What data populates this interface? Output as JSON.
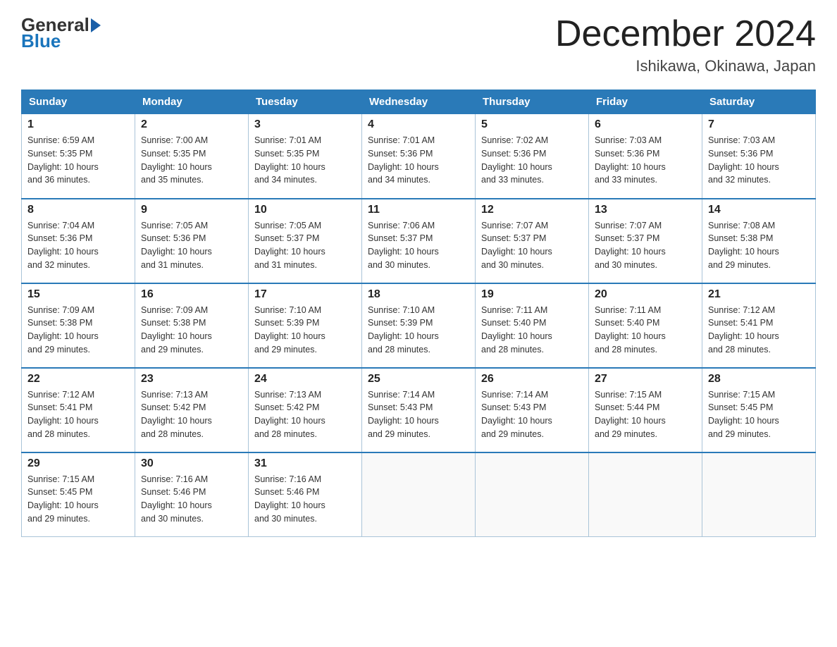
{
  "logo": {
    "general": "General",
    "blue": "Blue"
  },
  "title": "December 2024",
  "location": "Ishikawa, Okinawa, Japan",
  "headers": [
    "Sunday",
    "Monday",
    "Tuesday",
    "Wednesday",
    "Thursday",
    "Friday",
    "Saturday"
  ],
  "weeks": [
    [
      {
        "day": "1",
        "sunrise": "6:59 AM",
        "sunset": "5:35 PM",
        "daylight": "10 hours and 36 minutes."
      },
      {
        "day": "2",
        "sunrise": "7:00 AM",
        "sunset": "5:35 PM",
        "daylight": "10 hours and 35 minutes."
      },
      {
        "day": "3",
        "sunrise": "7:01 AM",
        "sunset": "5:35 PM",
        "daylight": "10 hours and 34 minutes."
      },
      {
        "day": "4",
        "sunrise": "7:01 AM",
        "sunset": "5:36 PM",
        "daylight": "10 hours and 34 minutes."
      },
      {
        "day": "5",
        "sunrise": "7:02 AM",
        "sunset": "5:36 PM",
        "daylight": "10 hours and 33 minutes."
      },
      {
        "day": "6",
        "sunrise": "7:03 AM",
        "sunset": "5:36 PM",
        "daylight": "10 hours and 33 minutes."
      },
      {
        "day": "7",
        "sunrise": "7:03 AM",
        "sunset": "5:36 PM",
        "daylight": "10 hours and 32 minutes."
      }
    ],
    [
      {
        "day": "8",
        "sunrise": "7:04 AM",
        "sunset": "5:36 PM",
        "daylight": "10 hours and 32 minutes."
      },
      {
        "day": "9",
        "sunrise": "7:05 AM",
        "sunset": "5:36 PM",
        "daylight": "10 hours and 31 minutes."
      },
      {
        "day": "10",
        "sunrise": "7:05 AM",
        "sunset": "5:37 PM",
        "daylight": "10 hours and 31 minutes."
      },
      {
        "day": "11",
        "sunrise": "7:06 AM",
        "sunset": "5:37 PM",
        "daylight": "10 hours and 30 minutes."
      },
      {
        "day": "12",
        "sunrise": "7:07 AM",
        "sunset": "5:37 PM",
        "daylight": "10 hours and 30 minutes."
      },
      {
        "day": "13",
        "sunrise": "7:07 AM",
        "sunset": "5:37 PM",
        "daylight": "10 hours and 30 minutes."
      },
      {
        "day": "14",
        "sunrise": "7:08 AM",
        "sunset": "5:38 PM",
        "daylight": "10 hours and 29 minutes."
      }
    ],
    [
      {
        "day": "15",
        "sunrise": "7:09 AM",
        "sunset": "5:38 PM",
        "daylight": "10 hours and 29 minutes."
      },
      {
        "day": "16",
        "sunrise": "7:09 AM",
        "sunset": "5:38 PM",
        "daylight": "10 hours and 29 minutes."
      },
      {
        "day": "17",
        "sunrise": "7:10 AM",
        "sunset": "5:39 PM",
        "daylight": "10 hours and 29 minutes."
      },
      {
        "day": "18",
        "sunrise": "7:10 AM",
        "sunset": "5:39 PM",
        "daylight": "10 hours and 28 minutes."
      },
      {
        "day": "19",
        "sunrise": "7:11 AM",
        "sunset": "5:40 PM",
        "daylight": "10 hours and 28 minutes."
      },
      {
        "day": "20",
        "sunrise": "7:11 AM",
        "sunset": "5:40 PM",
        "daylight": "10 hours and 28 minutes."
      },
      {
        "day": "21",
        "sunrise": "7:12 AM",
        "sunset": "5:41 PM",
        "daylight": "10 hours and 28 minutes."
      }
    ],
    [
      {
        "day": "22",
        "sunrise": "7:12 AM",
        "sunset": "5:41 PM",
        "daylight": "10 hours and 28 minutes."
      },
      {
        "day": "23",
        "sunrise": "7:13 AM",
        "sunset": "5:42 PM",
        "daylight": "10 hours and 28 minutes."
      },
      {
        "day": "24",
        "sunrise": "7:13 AM",
        "sunset": "5:42 PM",
        "daylight": "10 hours and 28 minutes."
      },
      {
        "day": "25",
        "sunrise": "7:14 AM",
        "sunset": "5:43 PM",
        "daylight": "10 hours and 29 minutes."
      },
      {
        "day": "26",
        "sunrise": "7:14 AM",
        "sunset": "5:43 PM",
        "daylight": "10 hours and 29 minutes."
      },
      {
        "day": "27",
        "sunrise": "7:15 AM",
        "sunset": "5:44 PM",
        "daylight": "10 hours and 29 minutes."
      },
      {
        "day": "28",
        "sunrise": "7:15 AM",
        "sunset": "5:45 PM",
        "daylight": "10 hours and 29 minutes."
      }
    ],
    [
      {
        "day": "29",
        "sunrise": "7:15 AM",
        "sunset": "5:45 PM",
        "daylight": "10 hours and 29 minutes."
      },
      {
        "day": "30",
        "sunrise": "7:16 AM",
        "sunset": "5:46 PM",
        "daylight": "10 hours and 30 minutes."
      },
      {
        "day": "31",
        "sunrise": "7:16 AM",
        "sunset": "5:46 PM",
        "daylight": "10 hours and 30 minutes."
      },
      null,
      null,
      null,
      null
    ]
  ],
  "labels": {
    "sunrise": "Sunrise:",
    "sunset": "Sunset:",
    "daylight": "Daylight:"
  }
}
